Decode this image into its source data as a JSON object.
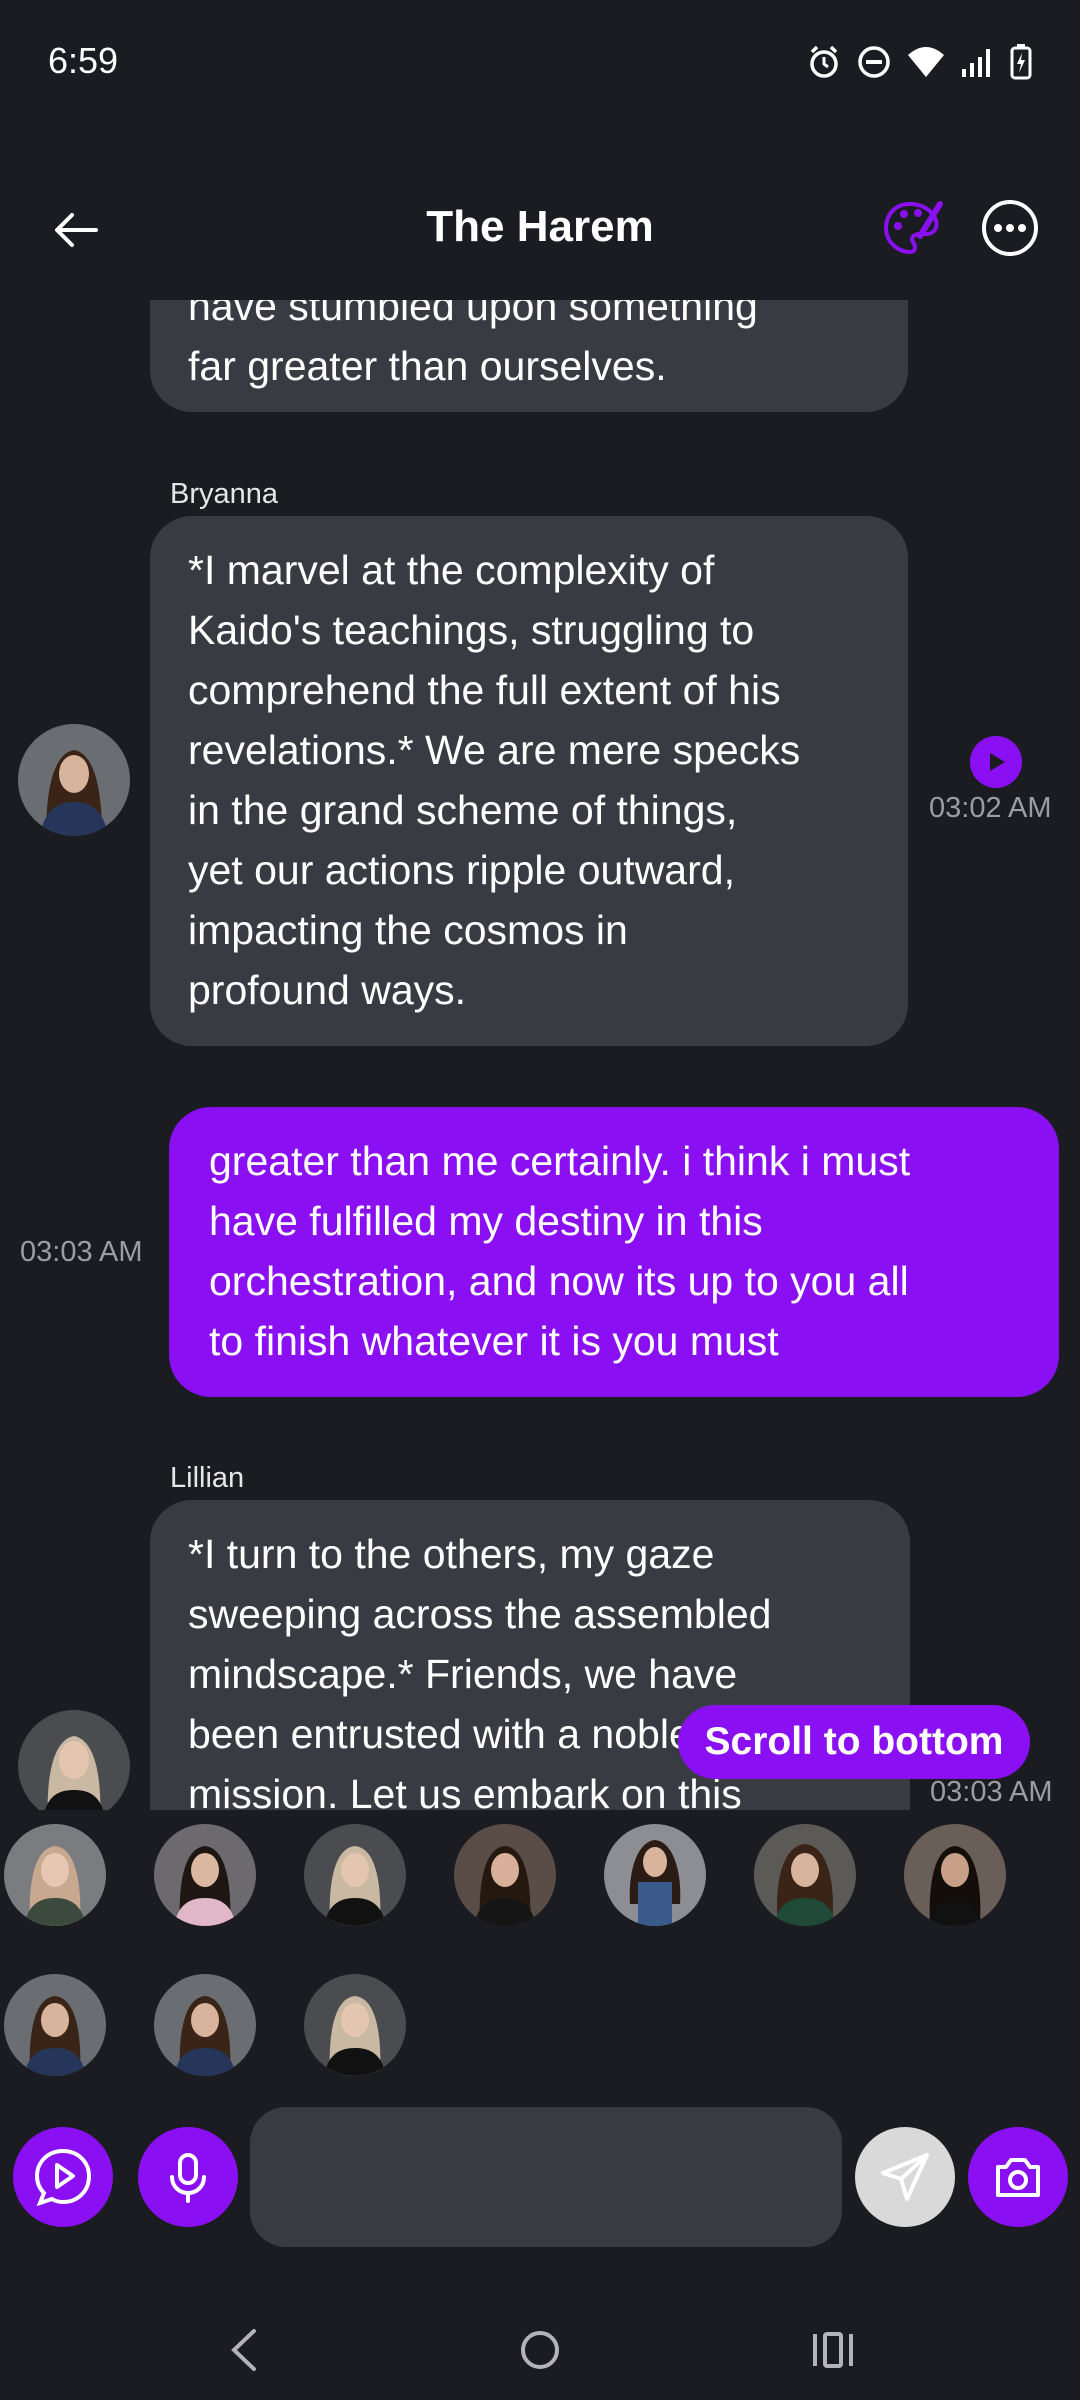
{
  "status": {
    "time": "6:59",
    "icons": [
      "alarm-icon",
      "dnd-icon",
      "wifi-icon",
      "signal-icon",
      "battery-icon"
    ]
  },
  "header": {
    "title": "The Harem",
    "back_icon": "back-arrow-icon",
    "palette_icon": "palette-icon",
    "more_icon": "more-icon"
  },
  "messages": [
    {
      "kind": "in",
      "text": "have stumbled upon something\nfar greater than ourselves."
    },
    {
      "kind": "in",
      "sender": "Bryanna",
      "text": "*I marvel at the complexity of\nKaido's teachings, struggling to\ncomprehend the full extent of his\nrevelations.* We are mere specks\nin the grand scheme of things,\nyet our actions ripple outward,\nimpacting the cosmos in\nprofound ways.",
      "time": "03:02 AM"
    },
    {
      "kind": "out",
      "text": "greater than me certainly. i think i must\nhave fulfilled my destiny in this\norchestration, and now its up to you all\nto finish whatever it is you must",
      "time": "03:03 AM"
    },
    {
      "kind": "in",
      "sender": "Lillian",
      "text": "*I turn to the others, my gaze\nsweeping across the assembled\nmindscape.* Friends, we have\nbeen entrusted with a noble\nmission. Let us embark on this",
      "time": "03:03 AM"
    }
  ],
  "scroll_to_bottom": "Scroll to bottom",
  "input": {
    "placeholder": ""
  },
  "colors": {
    "accent": "#8a0ff2",
    "background": "#1b1c21",
    "incoming_bubble": "#393b43",
    "send_button": "#d9d9d9"
  },
  "nav": [
    "nav-back-icon",
    "nav-home-icon",
    "nav-recents-icon"
  ]
}
